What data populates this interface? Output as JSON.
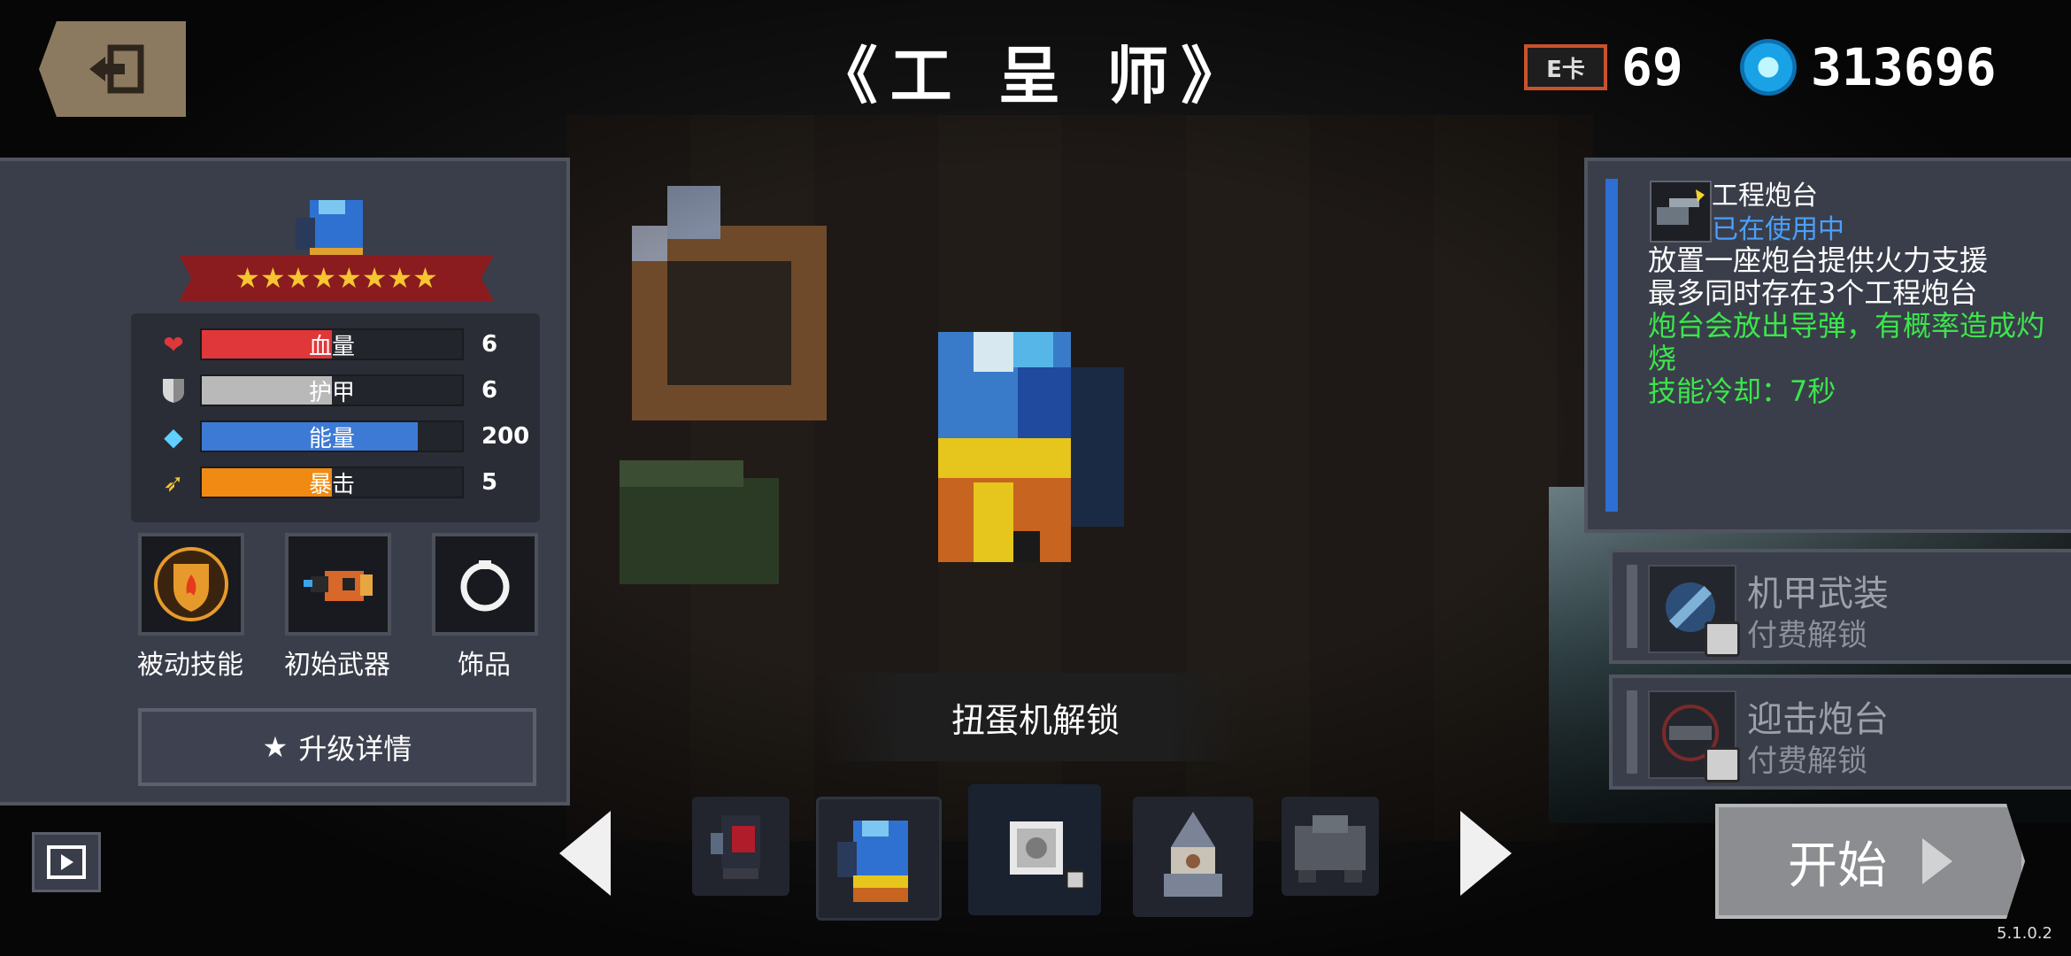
{
  "header": {
    "title": "《工 呈 师》",
    "card_icon_text": "E卡",
    "card_count": "69",
    "gem_count": "313696",
    "exit_icon": "exit-door-icon"
  },
  "hero": {
    "stars": "★★★★★★★★",
    "star_count": 8,
    "stats": [
      {
        "icon": "heart-icon",
        "label": "血量",
        "value": "6",
        "fill": 0.5,
        "color": "#e0373a"
      },
      {
        "icon": "shield-icon",
        "label": "护甲",
        "value": "6",
        "fill": 0.5,
        "color": "#b9b9b9"
      },
      {
        "icon": "energy-diamond-icon",
        "label": "能量",
        "value": "200",
        "fill": 0.83,
        "color": "#3d7ad6"
      },
      {
        "icon": "crit-icon",
        "label": "暴击",
        "value": "5",
        "fill": 0.5,
        "color": "#f08a12"
      }
    ],
    "slots": [
      {
        "label": "被动技能",
        "icon": "passive-skill-shield-icon"
      },
      {
        "label": "初始武器",
        "icon": "starter-weapon-icon"
      },
      {
        "label": "饰品",
        "icon": "accessory-ring-icon"
      }
    ],
    "upgrade_label": "升级详情",
    "upgrade_icon": "★"
  },
  "center": {
    "unlock_text": "扭蛋机解锁",
    "carousel": [
      {
        "name": "char-robot-red-icon"
      },
      {
        "name": "char-engineer-icon"
      },
      {
        "name": "char-locked-box-icon"
      },
      {
        "name": "char-wizard-icon"
      },
      {
        "name": "char-mech-icon"
      }
    ]
  },
  "skills": {
    "active": {
      "name": "工程炮台",
      "status": "已在使用中",
      "desc_white_1": "放置一座炮台提供火力支援",
      "desc_white_2": "最多同时存在3个工程炮台",
      "desc_green_1": "炮台会放出导弹，有概率造成灼烧",
      "desc_green_2": "技能冷却：7秒"
    },
    "locked": [
      {
        "name": "机甲武装",
        "lock_text": "付费解锁"
      },
      {
        "name": "迎击炮台",
        "lock_text": "付费解锁"
      }
    ]
  },
  "footer": {
    "start_label": "开始",
    "version": "5.1.0.2"
  },
  "colors": {
    "panel": "#3a3e4a",
    "accent_blue": "#2d6fd3",
    "green_text": "#3be64b",
    "status_blue": "#4aa0ff"
  }
}
